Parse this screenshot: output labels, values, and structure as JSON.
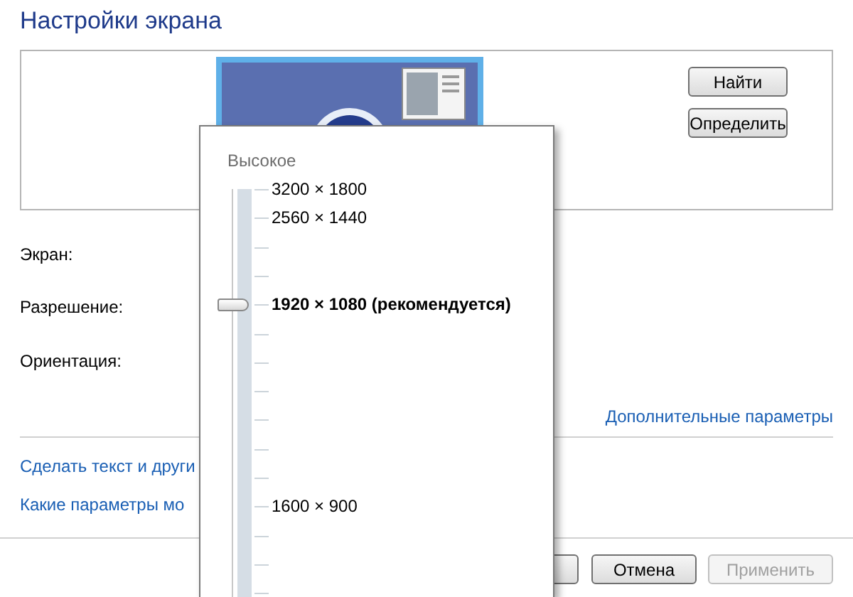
{
  "title": "Настройки экрана",
  "display_buttons": [
    {
      "label": "Найти"
    },
    {
      "label": "Определить"
    }
  ],
  "fields": [
    {
      "label": "Экран:"
    },
    {
      "label": "Разрешение:"
    },
    {
      "label": "Ориентация:"
    }
  ],
  "advanced_link": "Дополнительные параметры",
  "links": [
    "Сделать текст и други",
    "Какие параметры мо"
  ],
  "footer_buttons": [
    {
      "label": "Отмена",
      "disabled": false
    },
    {
      "label": "Применить",
      "disabled": true
    }
  ],
  "resolution_popup": {
    "heading": "Высокое",
    "slider": {
      "level": 0.73
    },
    "options": [
      {
        "label": "3200 × 1800",
        "selected": false
      },
      {
        "label": "2560 × 1440",
        "selected": false
      },
      {
        "label": "1920 × 1080 (рекомендуется)",
        "selected": true
      },
      {
        "label": "1600 × 900",
        "selected": false
      }
    ]
  }
}
